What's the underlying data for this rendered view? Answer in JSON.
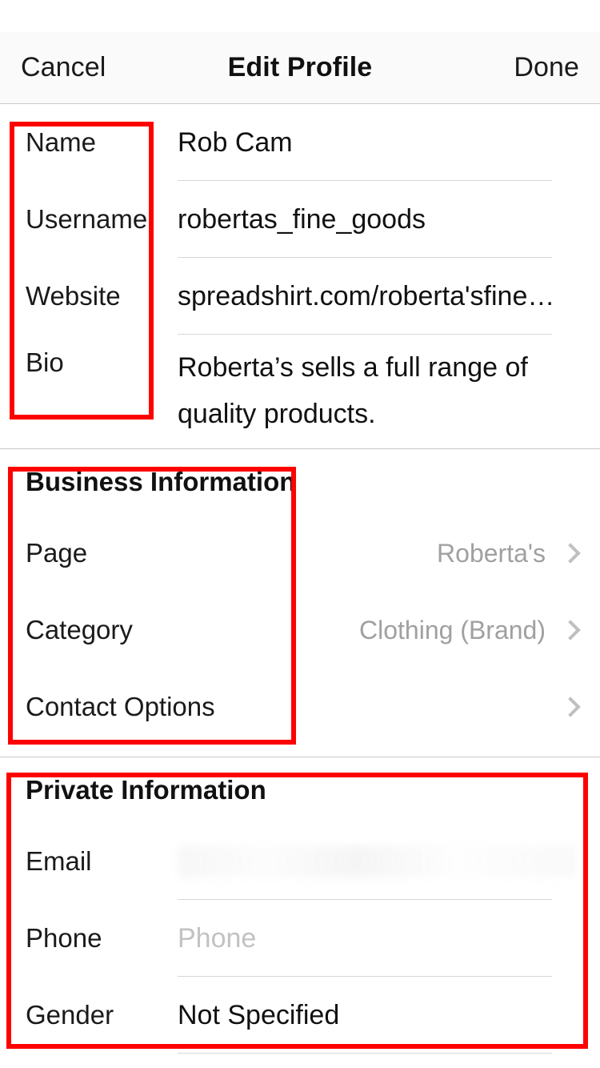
{
  "navbar": {
    "cancel_label": "Cancel",
    "title": "Edit Profile",
    "done_label": "Done"
  },
  "profile_section": {
    "rows": [
      {
        "label": "Name",
        "value": "Rob Cam"
      },
      {
        "label": "Username",
        "value": "robertas_fine_goods"
      },
      {
        "label": "Website",
        "value": "spreadshirt.com/roberta'sfine…"
      },
      {
        "label": "Bio",
        "value": "Roberta’s sells a full range of quality products."
      }
    ]
  },
  "business_section": {
    "heading": "Business Information",
    "rows": [
      {
        "label": "Page",
        "value": "Roberta's",
        "accessory": "chevron-right-icon"
      },
      {
        "label": "Category",
        "value": "Clothing (Brand)",
        "accessory": "chevron-right-icon"
      },
      {
        "label": "Contact Options",
        "value": "",
        "accessory": "chevron-right-icon"
      }
    ]
  },
  "private_section": {
    "heading": "Private Information",
    "rows": [
      {
        "label": "Email",
        "value": "",
        "placeholder": ""
      },
      {
        "label": "Phone",
        "value": "",
        "placeholder": "Phone"
      },
      {
        "label": "Gender",
        "value": "Not Specified",
        "placeholder": ""
      }
    ]
  },
  "colors": {
    "annotation": "#ff0000",
    "navbar_bg": "#fafafa",
    "text_primary": "#111111",
    "text_muted": "#a0a0a0",
    "placeholder": "#c2c2c2",
    "divider": "#d6d6d6"
  }
}
